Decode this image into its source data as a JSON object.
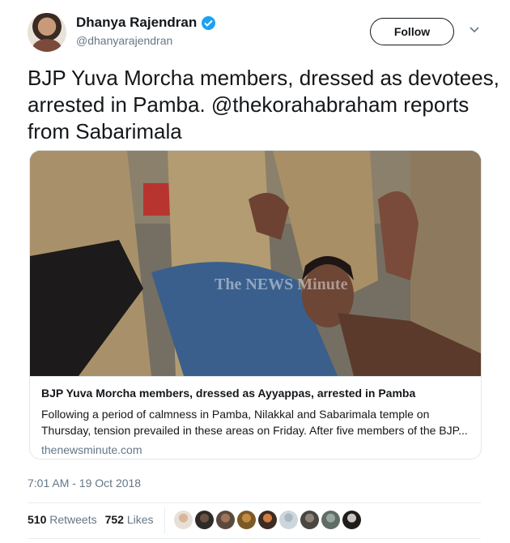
{
  "author": {
    "name": "Dhanya Rajendran",
    "handle": "@dhanyarajendran"
  },
  "follow_label": "Follow",
  "tweet_text": "BJP Yuva Morcha members, dressed as devotees, arrested in Pamba. @thekorahabraham reports from Sabarimala",
  "card": {
    "watermark": "The NEWS Minute",
    "title": "BJP Yuva Morcha members, dressed as Ayyappas, arrested in Pamba",
    "description": "Following a period of calmness in Pamba, Nilakkal and Sabarimala temple on Thursday, tension prevailed in these areas on Friday. After five members of the BJP...",
    "domain": "thenewsminute.com"
  },
  "timestamp": "7:01 AM - 19 Oct 2018",
  "stats": {
    "retweets_count": "510",
    "retweets_label": "Retweets",
    "likes_count": "752",
    "likes_label": "Likes"
  },
  "colors": {
    "accent": "#1da1f2",
    "muted": "#657786",
    "text": "#14171a"
  }
}
